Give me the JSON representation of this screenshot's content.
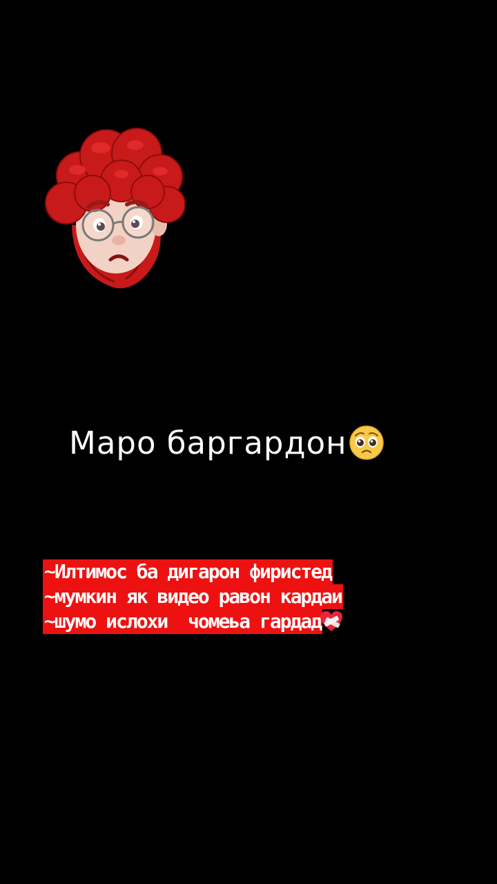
{
  "title": {
    "text": "Маро баргардон",
    "emoji": "pleading-face-icon"
  },
  "caption": {
    "lines": [
      "~Илтимос ба дигарон фиристед",
      "~мумкин як видео равон кардаи",
      "~шумо ислохи  чомеьа гардад"
    ],
    "trailing_emoji": "mending-heart-icon"
  },
  "avatar": {
    "icon": "memoji-sad-avatar-icon"
  },
  "colors": {
    "background": "#000000",
    "caption_highlight": "#ee1111",
    "text": "#ffffff"
  }
}
